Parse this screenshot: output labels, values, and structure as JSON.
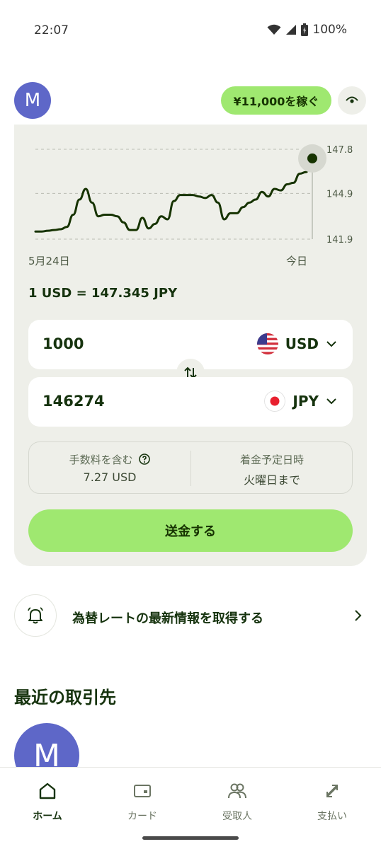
{
  "status_bar": {
    "time": "22:07",
    "battery": "100%"
  },
  "header": {
    "avatar_initial": "M",
    "earn_button_label": "¥11,000を稼ぐ"
  },
  "chart_data": {
    "type": "line",
    "x_labels": [
      "5月24日",
      "今日"
    ],
    "y_ticks": [
      "147.8",
      "144.9",
      "141.9"
    ],
    "ylim": [
      141.9,
      147.8
    ],
    "grid": true,
    "y": [
      142.4,
      142.4,
      142.45,
      142.5,
      142.55,
      142.7,
      143.5,
      144.5,
      145.2,
      144.3,
      143.4,
      143.5,
      143.5,
      143.4,
      143.0,
      142.5,
      142.5,
      143.3,
      142.6,
      142.9,
      143.4,
      143.2,
      144.4,
      144.8,
      144.8,
      144.8,
      144.7,
      144.6,
      144.8,
      144.3,
      143.2,
      143.6,
      143.6,
      144.0,
      144.3,
      144.5,
      145.0,
      144.7,
      145.2,
      145.1,
      145.5,
      145.6,
      146.2,
      146.3,
      147.2
    ]
  },
  "exchange": {
    "rate_text": "1 USD = 147.345 JPY",
    "send_amount": "1000",
    "send_currency": "USD",
    "receive_amount": "146274",
    "receive_currency": "JPY"
  },
  "info": {
    "fee_label": "手数料を含む",
    "fee_value": "7.27 USD",
    "arrival_label": "着金予定日時",
    "arrival_value": "火曜日まで"
  },
  "send_button_label": "送金する",
  "alert_row_label": "為替レートの最新情報を取得する",
  "recent": {
    "title": "最近の取引先",
    "avatar_initial": "M"
  },
  "nav": {
    "home": "ホーム",
    "card": "カード",
    "recipients": "受取人",
    "payments": "支払い"
  },
  "colors": {
    "accent": "#9fe870",
    "text_primary": "#16330e",
    "card_bg": "#eeefe9",
    "avatar": "#5e67c8"
  }
}
